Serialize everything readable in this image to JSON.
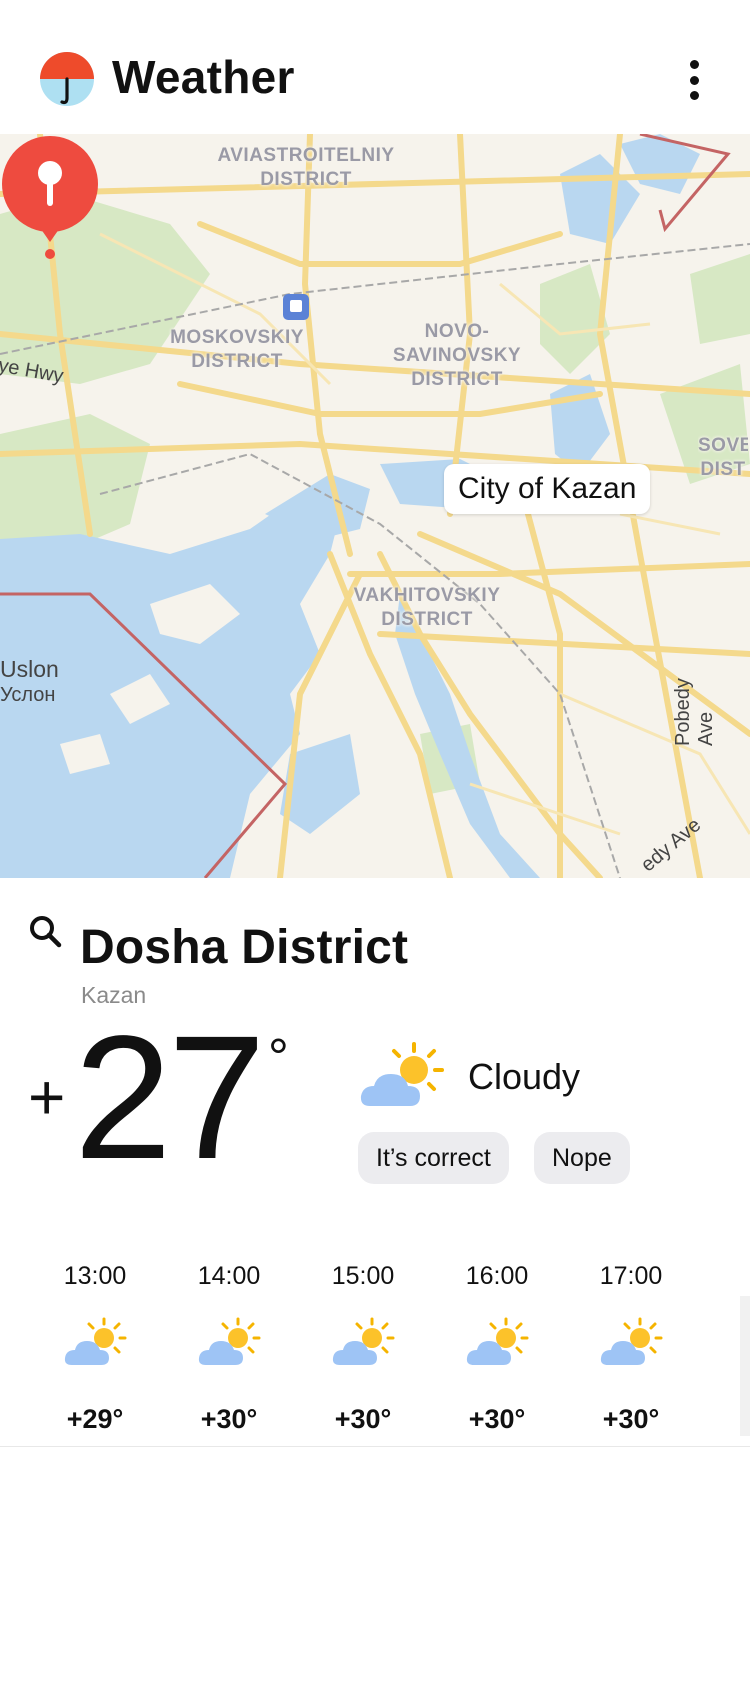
{
  "app": {
    "title": "Weather",
    "logo_icon": "umbrella-icon",
    "menu_icon": "more-vertical-icon"
  },
  "map": {
    "districts": [
      "AVIASTROITELNIY DISTRICT",
      "MOSKOVSKIY DISTRICT",
      "NOVO-SAVINOVSKY DISTRICT",
      "VAKHITOVSKIY DISTRICT",
      "SOVE DIST"
    ],
    "roads": [
      "ye Hwy",
      "Pobedy Ave",
      "edy Ave"
    ],
    "places": [
      "Uslon",
      "Услон"
    ],
    "city_label": "City of Kazan",
    "pin_icon": "location-pin-icon",
    "station_icon": "train-station-icon",
    "colors": {
      "land": "#f6f3ec",
      "water": "#b9d7f0",
      "road": "#f4d98c",
      "park": "#d7e8c4",
      "boundary": "#c46464"
    }
  },
  "location": {
    "name": "Dosha District",
    "city": "Kazan",
    "search_icon": "search-icon"
  },
  "current": {
    "sign": "+",
    "temperature": "27",
    "degree": "°",
    "condition": "Cloudy",
    "condition_icon": "partly-cloudy-icon",
    "confirm_label": "It’s correct",
    "deny_label": "Nope"
  },
  "hourly": [
    {
      "time": "13:00",
      "temp": "+29°",
      "icon": "partly-cloudy-icon"
    },
    {
      "time": "14:00",
      "temp": "+30°",
      "icon": "partly-cloudy-icon"
    },
    {
      "time": "15:00",
      "temp": "+30°",
      "icon": "partly-cloudy-icon"
    },
    {
      "time": "16:00",
      "temp": "+30°",
      "icon": "partly-cloudy-icon"
    },
    {
      "time": "17:00",
      "temp": "+30°",
      "icon": "partly-cloudy-icon"
    }
  ]
}
